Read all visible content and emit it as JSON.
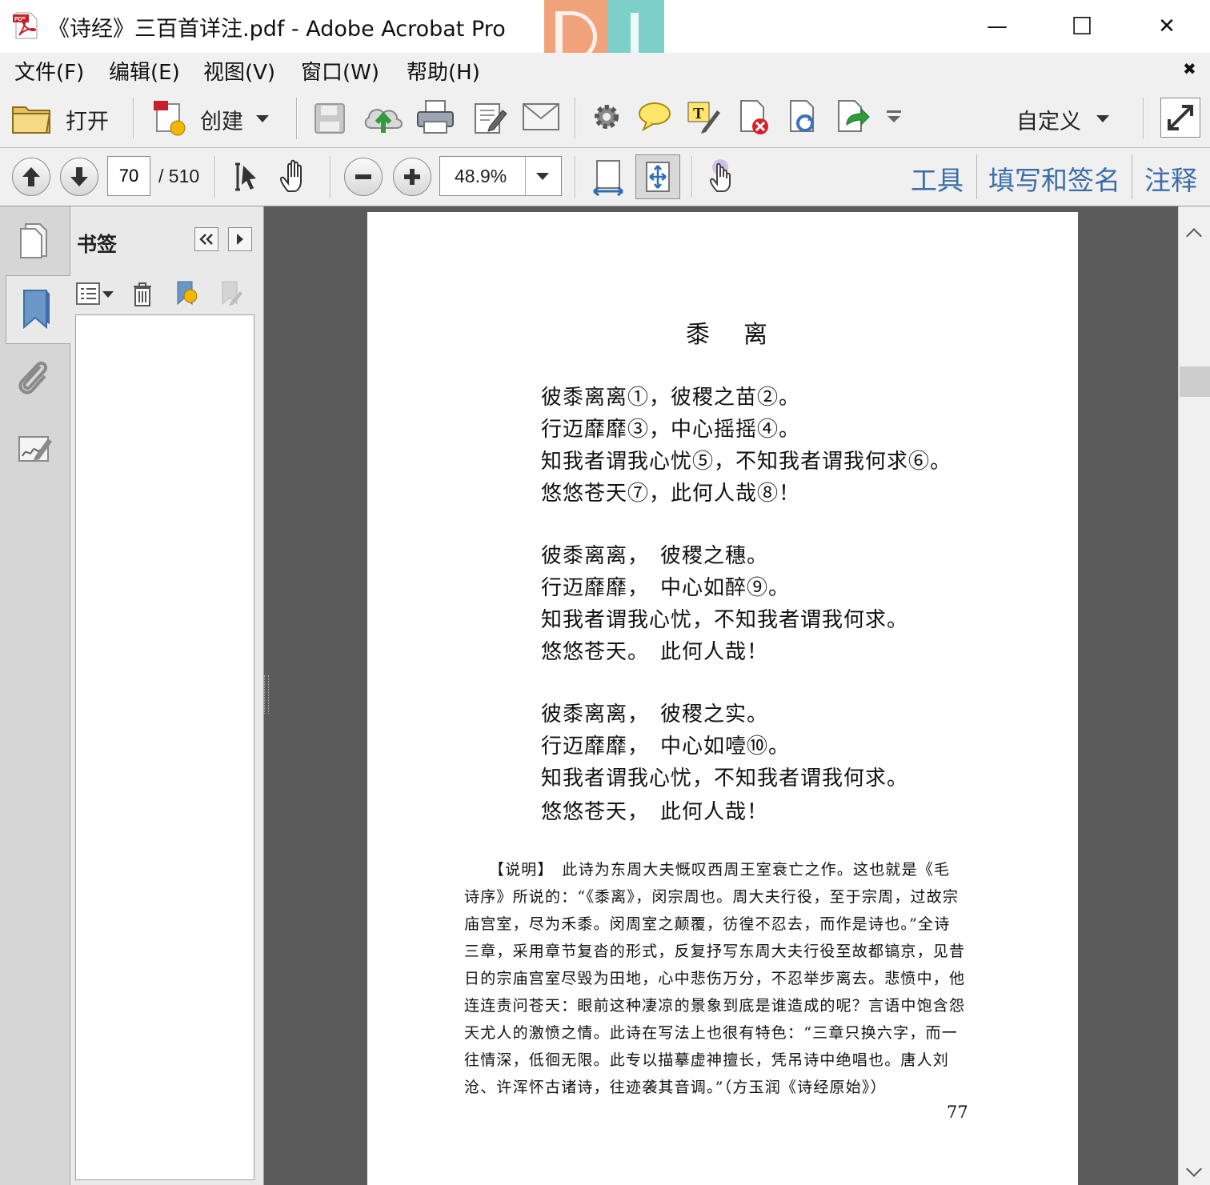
{
  "window": {
    "title": "《诗经》三百首详注.pdf - Adobe Acrobat Pro",
    "minimize_glyph": "—",
    "maximize_glyph": "☐",
    "close_glyph": "✕",
    "menubar_close_glyph": "✖"
  },
  "menu": [
    "文件(F)",
    "编辑(E)",
    "视图(V)",
    "窗口(W)",
    "帮助(H)"
  ],
  "toolbar": {
    "open_label": "打开",
    "create_label": "创建",
    "customize_label": "自定义"
  },
  "nav": {
    "page_number": "70",
    "page_total": "/ 510",
    "zoom": "48.9%"
  },
  "panes": {
    "tools": "工具",
    "fill_sign": "填写和签名",
    "comment": "注释"
  },
  "bookmarks": {
    "title": "书签"
  },
  "document": {
    "heading": "黍　离",
    "stanzas": [
      [
        "彼黍离离①，彼稷之苗②。",
        "行迈靡靡③，中心摇摇④。",
        "知我者谓我心忧⑤，不知我者谓我何求⑥。",
        "悠悠苍天⑦，此何人哉⑧！"
      ],
      [
        "彼黍离离，　彼稷之穗。",
        "行迈靡靡，　中心如醉⑨。",
        "知我者谓我心忧，不知我者谓我何求。",
        "悠悠苍天。　此何人哉！"
      ],
      [
        "彼黍离离，　彼稷之实。",
        "行迈靡靡，　中心如噎⑩。",
        "知我者谓我心忧，不知我者谓我何求。",
        "悠悠苍天，　此何人哉！"
      ]
    ],
    "note_lines": [
      "　　【说明】　此诗为东周大夫慨叹西周王室衰亡之作。这也就是《毛",
      "诗序》所说的：“《黍离》，闵宗周也。周大夫行役，至于宗周，过故宗",
      "庙宫室，尽为禾黍。闵周室之颠覆，彷徨不忍去，而作是诗也。”全诗",
      "三章，采用章节复沓的形式，反复抒写东周大夫行役至故都镐京，见昔",
      "日的宗庙宫室尽毁为田地，心中悲伤万分，不忍举步离去。悲愤中，他",
      "连连责问苍天：眼前这种凄凉的景象到底是谁造成的呢？言语中饱含怨",
      "天尤人的激愤之情。此诗在写法上也很有特色：“三章只换六字，而一",
      "往情深，低徊无限。此专以描摹虚神擅长，凭吊诗中绝唱也。唐人刘",
      "沧、许浑怀古诸诗，往迹袭其音调。”（方玉润《诗经原始》）"
    ],
    "page_footer": "77"
  },
  "colors": {
    "accent_blue": "#3b6ea8",
    "doc_background": "#5b5b5b",
    "watermark_orange": "#f0a37a",
    "watermark_teal": "#7dcfca"
  }
}
